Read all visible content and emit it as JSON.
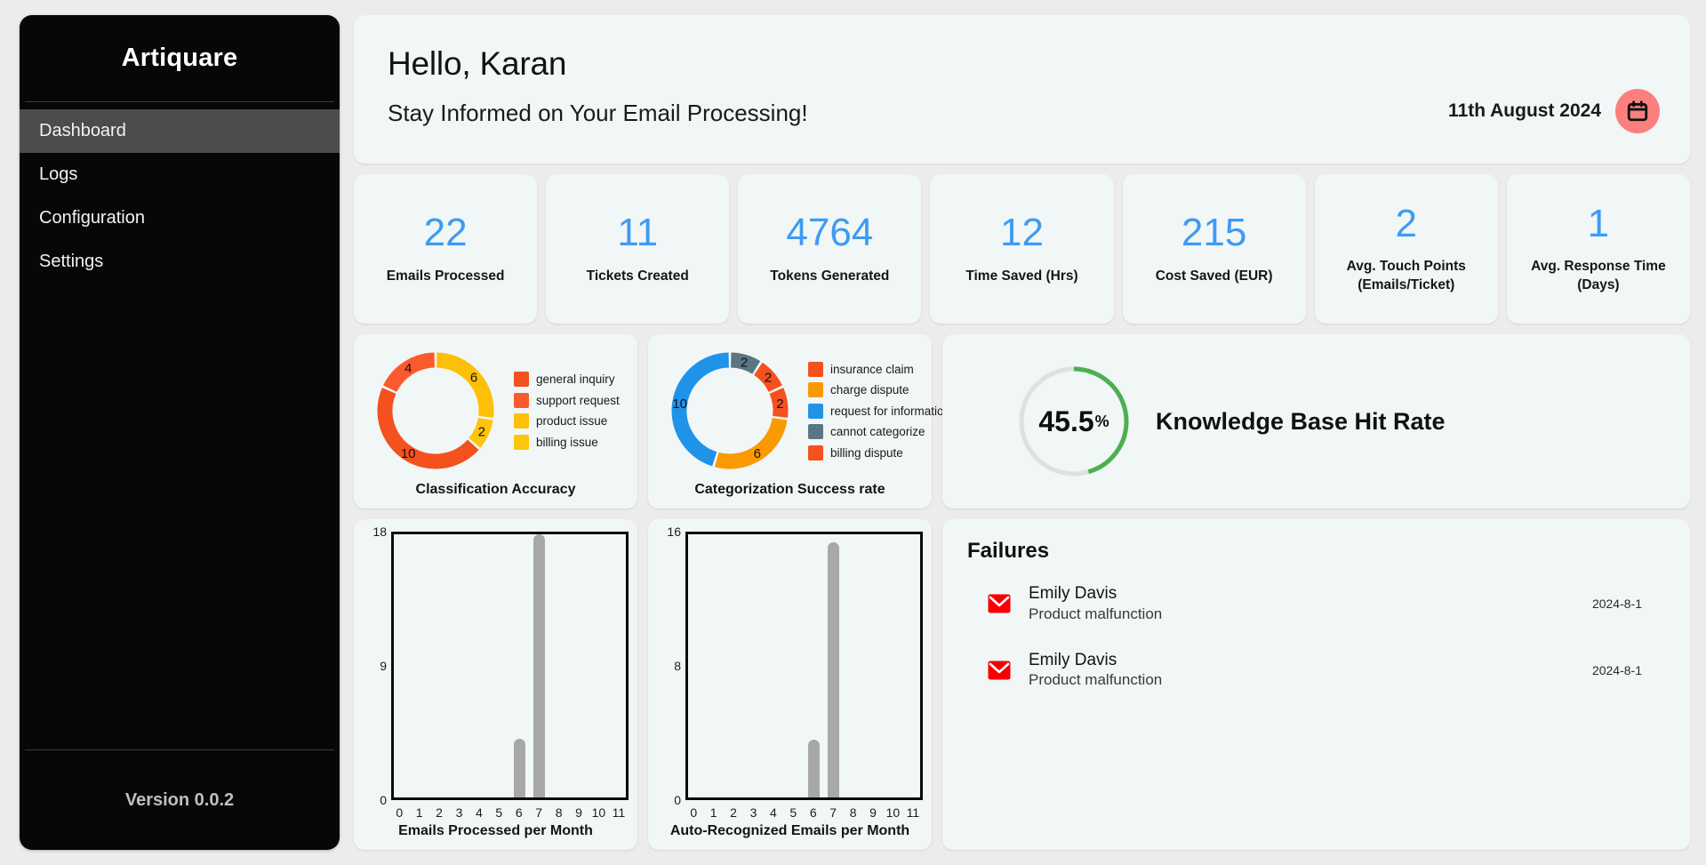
{
  "sidebar": {
    "brand": "Artiquare",
    "items": [
      {
        "label": "Dashboard",
        "active": true
      },
      {
        "label": "Logs",
        "active": false
      },
      {
        "label": "Configuration",
        "active": false
      },
      {
        "label": "Settings",
        "active": false
      }
    ],
    "version": "Version 0.0.2"
  },
  "header": {
    "greeting": "Hello, Karan",
    "subtitle": "Stay Informed on Your Email Processing!",
    "date": "11th August 2024",
    "calendar_icon": "calendar-icon",
    "calendar_badge_color": "#fb7f7f"
  },
  "kpis": [
    {
      "value": "22",
      "label": "Emails Processed"
    },
    {
      "value": "11",
      "label": "Tickets Created"
    },
    {
      "value": "4764",
      "label": "Tokens Generated"
    },
    {
      "value": "12",
      "label": "Time Saved (Hrs)"
    },
    {
      "value": "215",
      "label": "Cost Saved (EUR)"
    },
    {
      "value": "2",
      "label": "Avg. Touch Points (Emails/Ticket)"
    },
    {
      "value": "1",
      "label": "Avg. Response Time (Days)"
    }
  ],
  "kpi_accent_color": "#3d9bf2",
  "knowledge_base": {
    "value": "45.5",
    "unit": "%",
    "title": "Knowledge Base Hit Rate",
    "percent": 45.5,
    "arc_color": "#4caf50",
    "track_color": "#e0e0e0"
  },
  "failures": {
    "title": "Failures",
    "items": [
      {
        "name": "Emily Davis",
        "reason": "Product malfunction",
        "date": "2024-8-1",
        "icon": "email-icon"
      },
      {
        "name": "Emily Davis",
        "reason": "Product malfunction",
        "date": "2024-8-1",
        "icon": "email-icon"
      }
    ],
    "icon_color": "#f60001"
  },
  "chart_data": [
    {
      "type": "pie",
      "title": "Classification Accuracy",
      "legend_position": "right",
      "total": 22,
      "labels": [
        "general inquiry",
        "support request",
        "product issue",
        "billing issue"
      ],
      "values": [
        10,
        4,
        6,
        2
      ],
      "colors": [
        "#f4511e",
        "#fb5a2d",
        "#fdc008",
        "#fdc50c"
      ],
      "segment_order_clockwise_from_top": [
        {
          "label": "product issue",
          "value": 6,
          "color": "#fdc008"
        },
        {
          "label": "billing issue",
          "value": 2,
          "color": "#fdc50c"
        },
        {
          "label": "general inquiry",
          "value": 10,
          "color": "#f4511e"
        },
        {
          "label": "support request",
          "value": 4,
          "color": "#fb5a2d"
        }
      ]
    },
    {
      "type": "pie",
      "title": "Categorization Success rate",
      "legend_position": "right",
      "total": 22,
      "labels": [
        "insurance claim",
        "charge dispute",
        "request for information",
        "cannot categorize",
        "billing dispute"
      ],
      "values": [
        2,
        6,
        10,
        2,
        2
      ],
      "colors": [
        "#f4511e",
        "#fb9a00",
        "#1f93e8",
        "#5a7684",
        "#f4511e"
      ],
      "segment_order_clockwise_from_top": [
        {
          "label": "cannot categorize",
          "value": 2,
          "color": "#5a7684"
        },
        {
          "label": "billing dispute",
          "value": 2,
          "color": "#f4511e"
        },
        {
          "label": "insurance claim",
          "value": 2,
          "color": "#f4511e"
        },
        {
          "label": "charge dispute",
          "value": 6,
          "color": "#fb9a00"
        },
        {
          "label": "request for information",
          "value": 10,
          "color": "#1f93e8"
        }
      ]
    },
    {
      "type": "bar",
      "title": "Emails Processed per Month",
      "xlabel": "",
      "ylabel": "",
      "categories": [
        "0",
        "1",
        "2",
        "3",
        "4",
        "5",
        "6",
        "7",
        "8",
        "9",
        "10",
        "11"
      ],
      "values": [
        0,
        0,
        0,
        0,
        0,
        0,
        4,
        18,
        0,
        0,
        0,
        0
      ],
      "yticks": [
        "0",
        "9",
        "18"
      ],
      "ylim": [
        0,
        18
      ],
      "bar_color": "#a8a8a8",
      "grid": false
    },
    {
      "type": "bar",
      "title": "Auto-Recognized Emails per Month",
      "xlabel": "",
      "ylabel": "",
      "categories": [
        "0",
        "1",
        "2",
        "3",
        "4",
        "5",
        "6",
        "7",
        "8",
        "9",
        "10",
        "11"
      ],
      "values": [
        0,
        0,
        0,
        0,
        0,
        0,
        3.5,
        15.5,
        0,
        0,
        0,
        0
      ],
      "yticks": [
        "0",
        "8",
        "16"
      ],
      "ylim": [
        0,
        16
      ],
      "bar_color": "#a8a8a8",
      "grid": false
    }
  ]
}
